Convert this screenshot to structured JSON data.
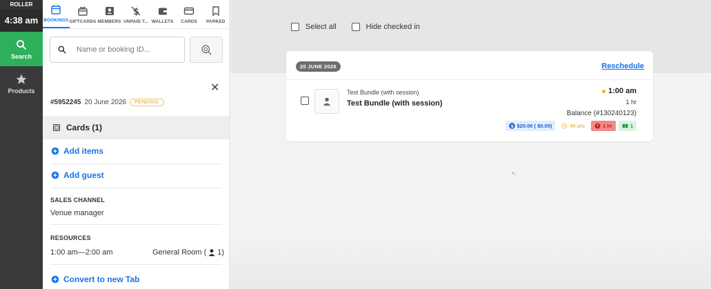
{
  "rail": {
    "brand": "ROLLER",
    "time": "4:38 am",
    "items": [
      {
        "label": "Search",
        "icon": "search-icon",
        "active": true
      },
      {
        "label": "Products",
        "icon": "star-icon",
        "active": false
      }
    ]
  },
  "panel": {
    "tabs": [
      {
        "label": "BOOKINGS",
        "icon": "calendar-icon",
        "active": true
      },
      {
        "label": "GIFTCARDS",
        "icon": "gift-icon",
        "active": false
      },
      {
        "label": "MEMBERS",
        "icon": "member-card-icon",
        "active": false
      },
      {
        "label": "UNPAID T...",
        "icon": "no-dollar-icon",
        "active": false
      },
      {
        "label": "WALLETS",
        "icon": "wallet-icon",
        "active": false
      },
      {
        "label": "CARDS",
        "icon": "credit-card-icon",
        "active": false
      },
      {
        "label": "PARKED",
        "icon": "bookmark-icon",
        "active": false
      }
    ],
    "search": {
      "placeholder": "Name or booking ID...",
      "value": ""
    },
    "booking": {
      "id": "#5952245",
      "date": "20 June 2026",
      "status": "PENDING",
      "cards_label": "Cards (1)",
      "add_items": "Add items",
      "add_guest": "Add guest",
      "sales_channel_label": "SALES CHANNEL",
      "sales_channel_value": "Venue manager",
      "resources_label": "RESOURCES",
      "resources_time": "1:00 am—2:00 am",
      "resources_room": "General Room (",
      "resources_count": "1)",
      "convert": "Convert to new Tab"
    }
  },
  "main": {
    "select_all": "Select all",
    "hide_checked_in": "Hide checked in",
    "group": {
      "date_chip": "20 JUNE 2026",
      "reschedule": "Reschedule",
      "booking": {
        "product_small": "Test Bundle (with session)",
        "product_name": "Test Bundle (with session)",
        "time": "1:00 am",
        "duration": "1 hr",
        "balance": "Balance  (#130240123)",
        "badge_money": "$20.00 ( $0.00)",
        "badge_points": "90 pts",
        "badge_time": "1 hr",
        "badge_tickets": "1"
      }
    }
  },
  "colors": {
    "accent": "#1a73e8",
    "rail_active": "#2eaf5a",
    "pending": "#e0a32a"
  }
}
